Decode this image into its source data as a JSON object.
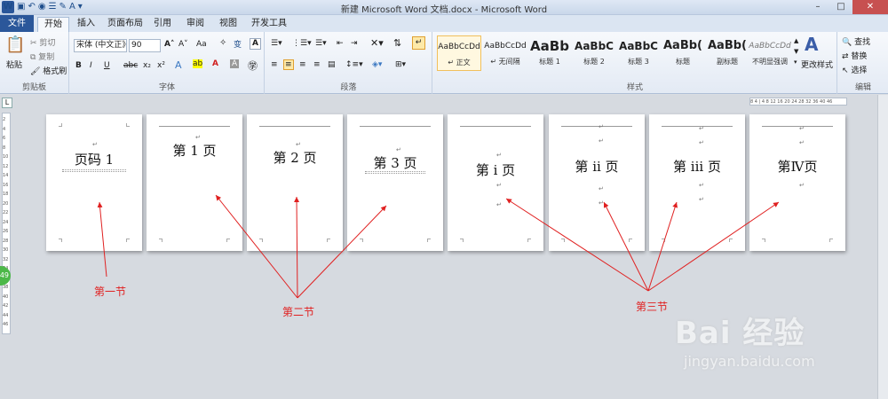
{
  "window": {
    "title": "新建 Microsoft Word 文档.docx - Microsoft Word",
    "app_icon": "W"
  },
  "tabs": [
    "文件",
    "开始",
    "插入",
    "页面布局",
    "引用",
    "审阅",
    "视图",
    "开发工具"
  ],
  "ribbon": {
    "clipboard": {
      "paste": "粘贴",
      "cut": "剪切",
      "copy": "复制",
      "format_painter": "格式刷",
      "group": "剪贴板"
    },
    "font": {
      "name": "宋体 (中文正》",
      "size": "90",
      "group": "字体",
      "bold": "B",
      "italic": "I",
      "underline": "U",
      "strike": "abc",
      "sub": "x₂",
      "sup": "x²",
      "grow": "A",
      "shrink": "A",
      "change_case": "Aa",
      "char_border": "A"
    },
    "paragraph": {
      "group": "段落"
    },
    "styles": {
      "group": "样式",
      "items": [
        {
          "sample": "AaBbCcDd",
          "name": "↵ 正文"
        },
        {
          "sample": "AaBbCcDd",
          "name": "↵ 无间隔"
        },
        {
          "sample": "AaBb",
          "name": "标题 1"
        },
        {
          "sample": "AaBbC",
          "name": "标题 2"
        },
        {
          "sample": "AaBbC",
          "name": "标题 3"
        },
        {
          "sample": "AaBb(",
          "name": "标题"
        },
        {
          "sample": "AaBb(",
          "name": "副标题"
        },
        {
          "sample": "AaBbCcDd",
          "name": "不明显强调"
        }
      ],
      "change_styles": "更改样式"
    },
    "editing": {
      "group": "编辑",
      "find": "查找",
      "replace": "替换",
      "select": "选择"
    }
  },
  "ruler": {
    "h_ticks": "8 4 | 4 8 12 16 20 24 28 32 36 40 46",
    "v_ticks": [
      "2",
      "4",
      "6",
      "8",
      "10",
      "12",
      "14",
      "16",
      "18",
      "20",
      "22",
      "24",
      "26",
      "28",
      "30",
      "32",
      "34",
      "36",
      "38",
      "40",
      "42",
      "44",
      "46"
    ]
  },
  "status_badge": "49",
  "pages": [
    {
      "text": "页码 1",
      "mark": "↵"
    },
    {
      "text": "第 1 页",
      "mark": "↵"
    },
    {
      "text": "第 2 页",
      "mark": "↵"
    },
    {
      "text": "第 3 页",
      "mark": "↵"
    },
    {
      "text": "第 i 页",
      "mark": "↵"
    },
    {
      "text": "第 ii 页",
      "mark": "↵"
    },
    {
      "text": "第 iii 页",
      "mark": "↵"
    },
    {
      "text": "第Ⅳ页",
      "mark": "↵"
    }
  ],
  "annotations": {
    "section1": "第一节",
    "section2": "第二节",
    "section3": "第三节"
  },
  "watermark": {
    "main": "Bai 经验",
    "sub": "jingyan.baidu.com"
  },
  "colors": {
    "annotation_red": "#e02020",
    "file_tab": "#2b579a"
  }
}
